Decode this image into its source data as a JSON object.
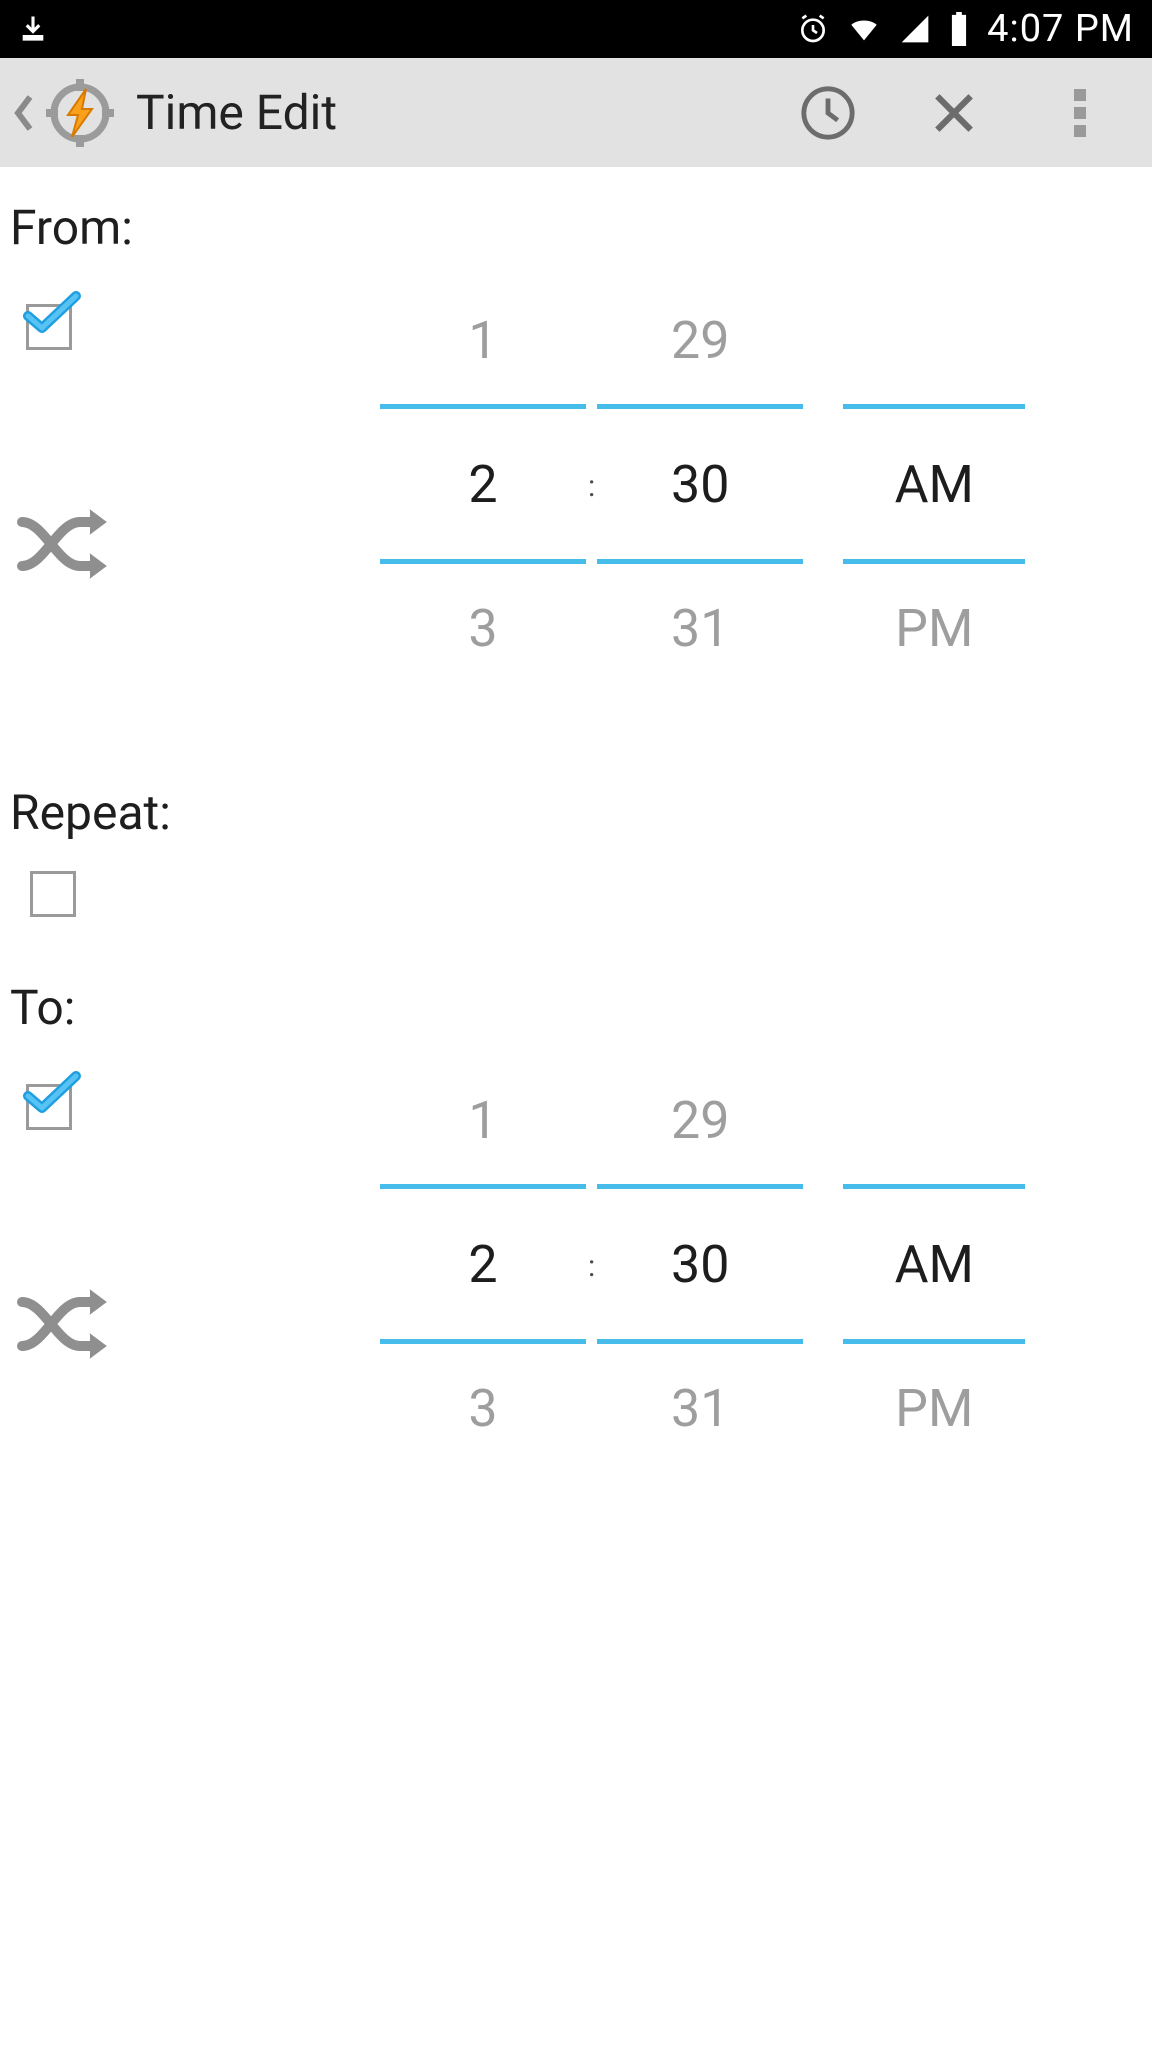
{
  "statusbar": {
    "time": "4:07 PM"
  },
  "appbar": {
    "title": "Time Edit"
  },
  "from": {
    "label": "From:",
    "checked": true,
    "picker": {
      "hour_prev": "1",
      "hour_sel": "2",
      "hour_next": "3",
      "min_prev": "29",
      "min_sel": "30",
      "min_next": "31",
      "ampm_prev": "",
      "ampm_sel": "AM",
      "ampm_next": "PM"
    }
  },
  "repeat": {
    "label": "Repeat:",
    "checked": false
  },
  "to": {
    "label": "To:",
    "checked": true,
    "picker": {
      "hour_prev": "1",
      "hour_sel": "2",
      "hour_next": "3",
      "min_prev": "29",
      "min_sel": "30",
      "min_next": "31",
      "ampm_prev": "",
      "ampm_sel": "AM",
      "ampm_next": "PM"
    }
  }
}
